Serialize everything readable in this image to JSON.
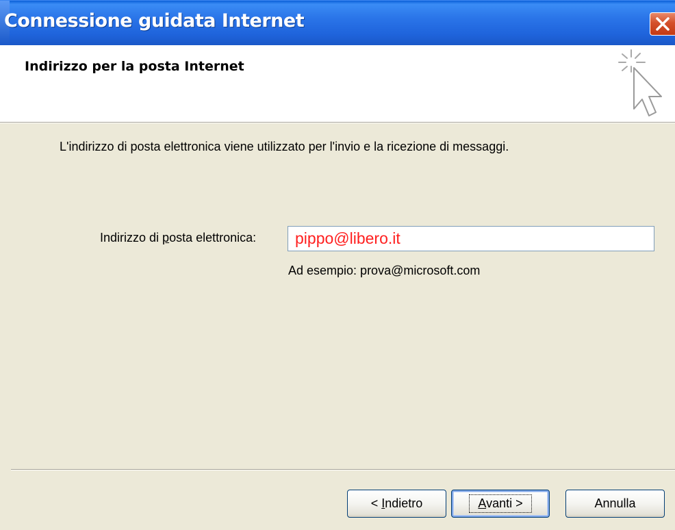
{
  "window": {
    "title": "Connessione guidata Internet",
    "close_icon": "close-icon"
  },
  "header": {
    "title": "Indirizzo per la posta Internet",
    "icon": "wizard-cursor-icon"
  },
  "body": {
    "description": "L'indirizzo di posta elettronica viene utilizzato per l'invio e la ricezione di messaggi.",
    "email_label_pre": "Indirizzo di ",
    "email_label_accel": "p",
    "email_label_post": "osta elettronica:",
    "email_value": "pippo@libero.it",
    "example": "Ad esempio: prova@microsoft.com"
  },
  "buttons": {
    "back_prefix": "< ",
    "back_accel": "I",
    "back_rest": "ndietro",
    "next_accel": "A",
    "next_rest": "vanti >",
    "cancel": "Annulla"
  },
  "colors": {
    "titlebar": "#2a74e8",
    "panel": "#ece9d8",
    "input_text": "#ff1f1f"
  }
}
